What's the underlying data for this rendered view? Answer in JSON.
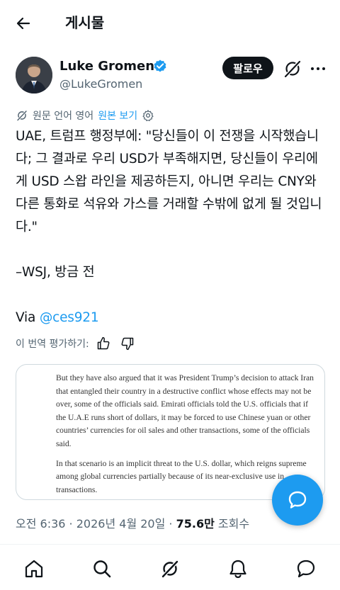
{
  "header": {
    "title": "게시물",
    "back_icon": "arrow-left-icon"
  },
  "author": {
    "name": "Luke Gromen",
    "handle": "@LukeGromen",
    "verified_color": "#1d9bf0",
    "follow_label": "팔로우"
  },
  "translation": {
    "source_label": "원문 언어 영어",
    "view_original": "원본 보기"
  },
  "post": {
    "body": "UAE, 트럼프 행정부에: \"당신들이 이 전쟁을 시작했습니다; 그 결과로 우리 USD가 부족해지면, 당신들이 우리에게 USD 스왑 라인을 제공하든지, 아니면 우리는 CNY와 다른 통화로 석유와 가스를 거래할 수밖에 없게 될 것입니다.\"\n\n–WSJ, 방금 전",
    "via_prefix": "Via ",
    "via_link": "@ces921"
  },
  "rating": {
    "label": "이 번역 평가하기:"
  },
  "media": {
    "paragraph1": "But they have also argued that it was President Trump’s decision to attack Iran that entangled their country in a destructive conflict whose effects may not be over, some of the officials said. Emirati officials told the U.S. officials that if the U.A.E runs short of dollars, it may be forced to use Chinese yuan or other countries’ currencies for oil sales and other transactions, some of the officials said.",
    "paragraph2": "In that scenario is an implicit threat to the U.S. dollar, which reigns supreme among global currencies partially because of its near-exclusive use in transactions."
  },
  "meta": {
    "time": "오전 6:36",
    "date": "2026년 4월 20일",
    "separator": " · ",
    "views_count": "75.6만",
    "views_label": " 조회수"
  },
  "colors": {
    "accent": "#1d9bf0",
    "text": "#0f1419",
    "secondary": "#536471"
  },
  "nav": [
    {
      "name": "home",
      "icon": "home-icon"
    },
    {
      "name": "search",
      "icon": "search-icon"
    },
    {
      "name": "grok",
      "icon": "grok-icon"
    },
    {
      "name": "notifications",
      "icon": "bell-icon"
    },
    {
      "name": "messages",
      "icon": "chat-icon"
    }
  ]
}
